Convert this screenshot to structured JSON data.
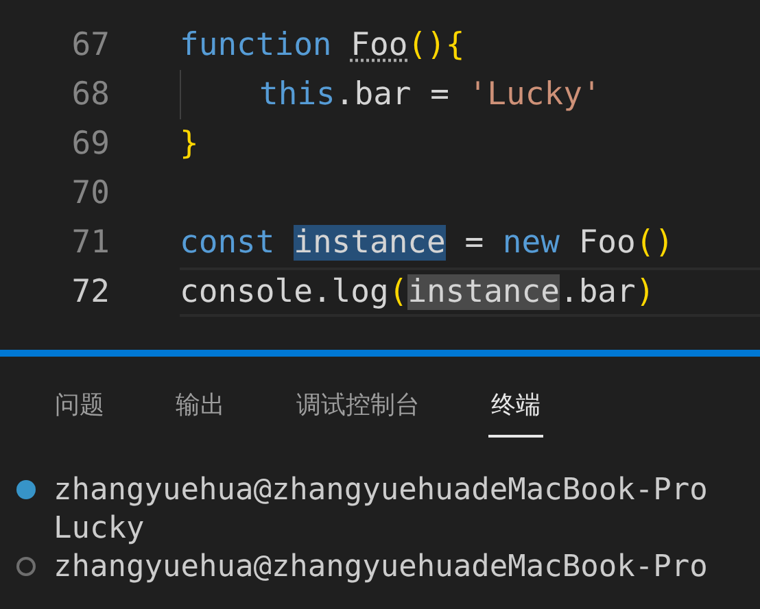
{
  "editor": {
    "lines": [
      {
        "number": "67",
        "current": false,
        "indented": false,
        "tokens": [
          {
            "text": "function ",
            "kind": "keyword"
          },
          {
            "text": "Foo",
            "kind": "plain",
            "hint": true
          },
          {
            "text": "(){",
            "kind": "bracket"
          }
        ]
      },
      {
        "number": "68",
        "current": false,
        "indented": true,
        "tokens": [
          {
            "text": "this",
            "kind": "keyword"
          },
          {
            "text": ".bar = ",
            "kind": "plain"
          },
          {
            "text": "'Lucky'",
            "kind": "string"
          }
        ]
      },
      {
        "number": "69",
        "current": false,
        "indented": false,
        "tokens": [
          {
            "text": "}",
            "kind": "bracket"
          }
        ]
      },
      {
        "number": "70",
        "current": false,
        "indented": false
      },
      {
        "number": "71",
        "current": false,
        "indented": false,
        "tokens": [
          {
            "text": "const ",
            "kind": "keyword"
          },
          {
            "text": "instance",
            "kind": "plain",
            "selected": true
          },
          {
            "text": " = ",
            "kind": "plain"
          },
          {
            "text": "new ",
            "kind": "keyword"
          },
          {
            "text": "Foo",
            "kind": "plain"
          },
          {
            "text": "()",
            "kind": "bracket"
          }
        ]
      },
      {
        "number": "72",
        "current": true,
        "indented": false,
        "tokens": [
          {
            "text": "console.log",
            "kind": "plain"
          },
          {
            "text": "(",
            "kind": "bracket"
          },
          {
            "text": "instance",
            "kind": "plain",
            "match": true
          },
          {
            "text": ".bar",
            "kind": "plain"
          },
          {
            "text": ")",
            "kind": "bracket"
          }
        ]
      }
    ]
  },
  "panel": {
    "tabs": [
      {
        "label": "问题",
        "selected": false
      },
      {
        "label": "输出",
        "selected": false
      },
      {
        "label": "调试控制台",
        "selected": false
      },
      {
        "label": "终端",
        "selected": true
      }
    ],
    "terminal": [
      {
        "kind": "prompt",
        "succeeded": true,
        "text": "zhangyuehua@zhangyuehuadeMacBook-Pro"
      },
      {
        "kind": "output",
        "text": "Lucky"
      },
      {
        "kind": "prompt",
        "succeeded": false,
        "text": "zhangyuehua@zhangyuehuadeMacBook-Pro"
      }
    ]
  }
}
